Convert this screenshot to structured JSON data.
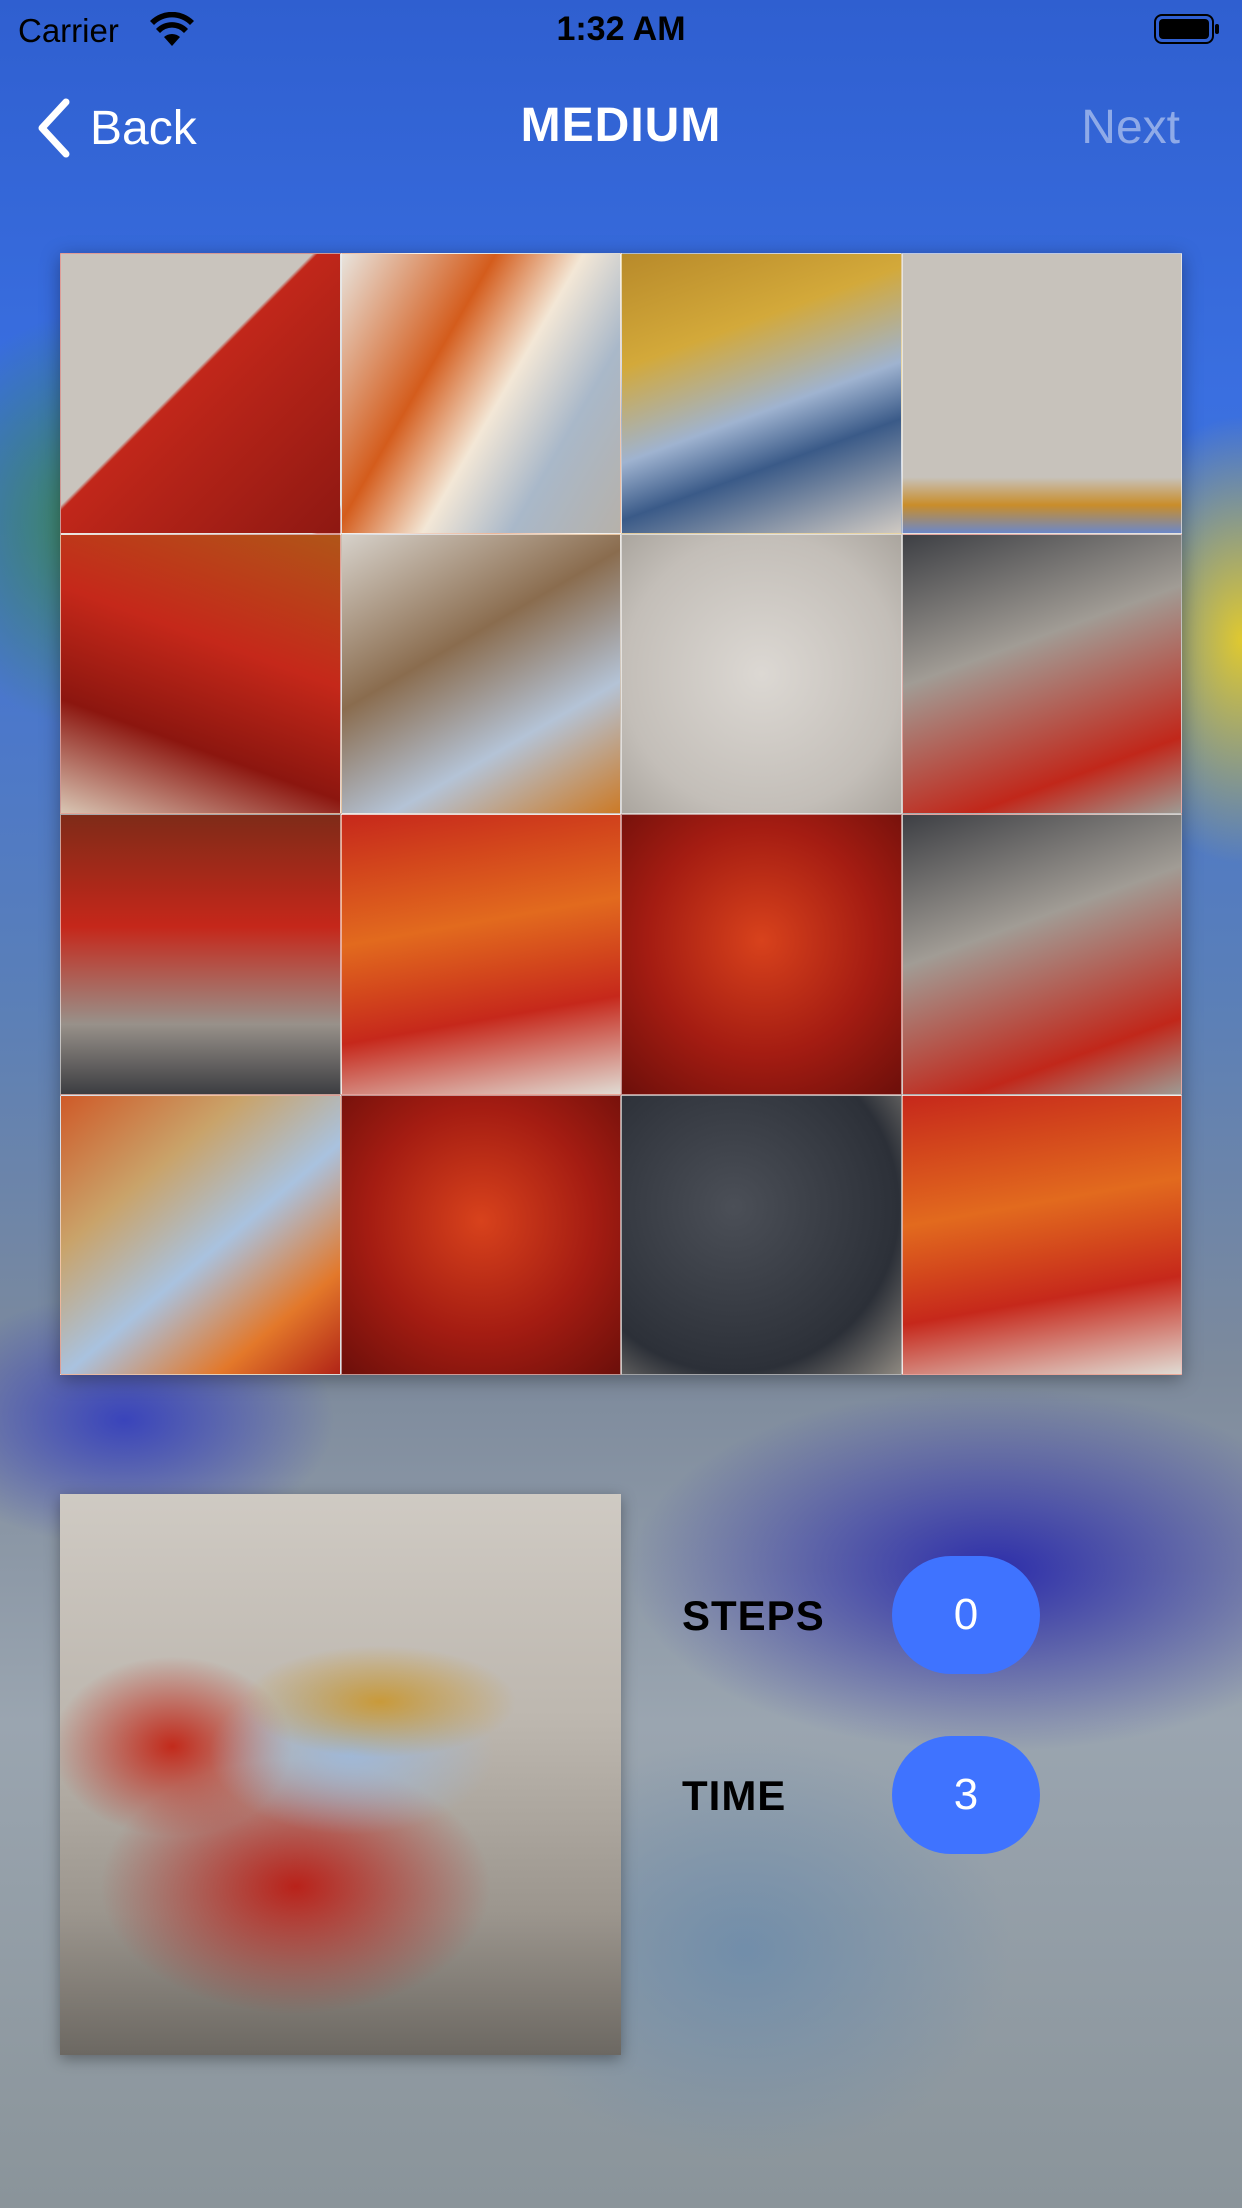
{
  "status_bar": {
    "carrier": "Carrier",
    "time": "1:32 AM"
  },
  "nav": {
    "back_label": "Back",
    "title": "MEDIUM",
    "next_label": "Next"
  },
  "board": {
    "rows": 4,
    "cols": 4
  },
  "stats": {
    "steps_label": "STEPS",
    "steps_value": "0",
    "time_label": "TIME",
    "time_value": "3"
  },
  "colors": {
    "accent": "#3f73ff",
    "title_text": "#ffffff",
    "next_disabled": "rgba(255,255,255,0.45)"
  },
  "icons": {
    "back": "chevron-left-icon",
    "wifi": "wifi-icon",
    "battery": "battery-icon"
  }
}
